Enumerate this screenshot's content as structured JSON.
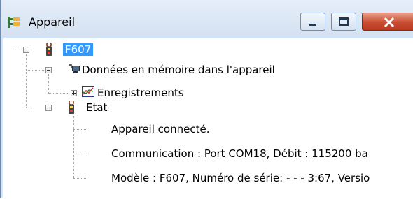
{
  "window": {
    "title": "Appareil",
    "icon": "device-tree-icon"
  },
  "tree": {
    "root": {
      "label": "F607",
      "icon": "clamp-meter-icon",
      "expanded": true,
      "selected": true
    },
    "memory": {
      "label": "Données en mémoire dans l'appareil",
      "icon": "computer-memory-icon",
      "expanded": true
    },
    "recordings": {
      "label": "Enregistrements",
      "icon": "chart-icon",
      "expanded": false
    },
    "state": {
      "label": "Etat",
      "icon": "clamp-meter-icon",
      "expanded": true
    },
    "state_items": [
      {
        "label": "Appareil connecté."
      },
      {
        "label": "Communication : Port COM18, Débit : 115200 ba"
      },
      {
        "label": "Modèle : F607, Numéro de série: - - - 3:67, Versio"
      }
    ]
  },
  "colors": {
    "selection": "#3399ff",
    "title_bg": "#dbe6f3",
    "close_button": "#c94d30"
  }
}
